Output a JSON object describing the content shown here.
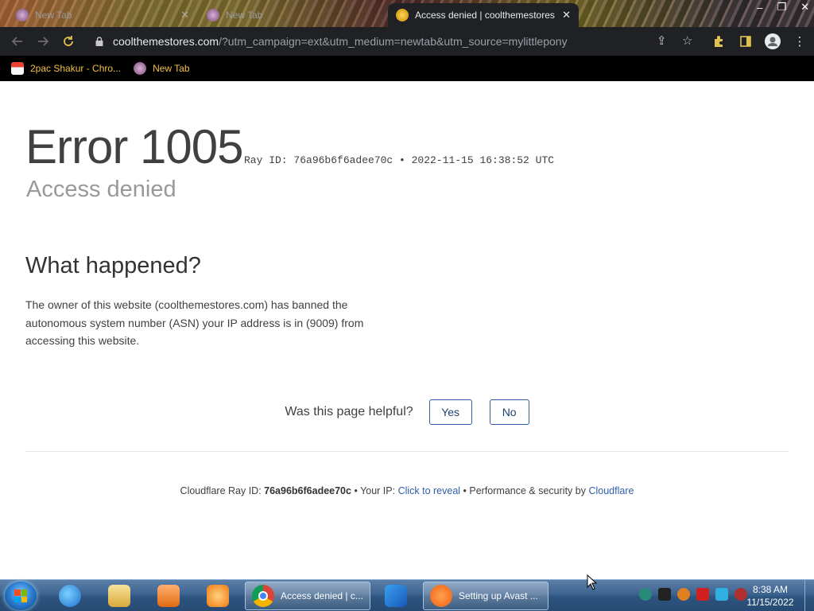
{
  "browser": {
    "tabs": [
      {
        "title": "New Tab",
        "active": false
      },
      {
        "title": "New Tab",
        "active": false
      },
      {
        "title": "Access denied | coolthemestores",
        "active": true
      }
    ],
    "address": {
      "host": "coolthemestores.com",
      "path": "/?utm_campaign=ext&utm_medium=newtab&utm_source=mylittlepony"
    },
    "bookmarks": [
      {
        "label": "2pac Shakur - Chro..."
      },
      {
        "label": "New Tab"
      }
    ],
    "colors": {
      "toolbar_bg": "#202124",
      "bookmarks_bg": "#000000",
      "bookmark_text": "#f0c040"
    }
  },
  "page": {
    "error_title": "Error 1005",
    "ray_line": "Ray ID: 76a96b6f6adee70c • 2022-11-15 16:38:52 UTC",
    "subtitle": "Access denied",
    "what_happened_heading": "What happened?",
    "what_happened_text": "The owner of this website (coolthemestores.com) has banned the autonomous system number (ASN) your IP address is in (9009) from accessing this website.",
    "helpful_question": "Was this page helpful?",
    "yes_label": "Yes",
    "no_label": "No",
    "footer": {
      "ray_prefix": "Cloudflare Ray ID: ",
      "ray_id": "76a96b6f6adee70c",
      "ip_prefix": " • Your IP: ",
      "ip_link": "Click to reveal",
      "perf_text": " • Performance & security by ",
      "cf_link": "Cloudflare"
    },
    "colors": {
      "link": "#2f5ea8",
      "button_border": "#2f5ea8"
    }
  },
  "taskbar": {
    "tasks": [
      {
        "label": "Access denied | c...",
        "icon": "chrome-icon"
      },
      {
        "label": "Setting up Avast ...",
        "icon": "avast-icon"
      }
    ],
    "clock_time": "8:38 AM",
    "clock_date": "11/15/2022"
  }
}
